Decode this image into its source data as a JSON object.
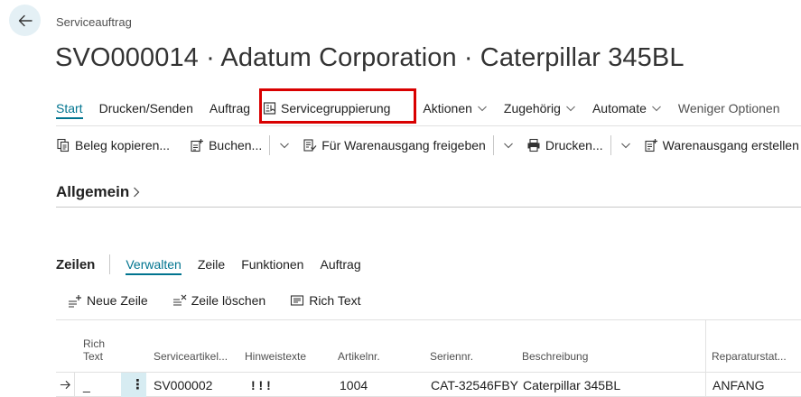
{
  "header": {
    "breadcrumb": "Serviceauftrag",
    "title": "SVO000014 · Adatum Corporation · Caterpillar 345BL"
  },
  "actionbar": {
    "items": [
      {
        "label": "Start"
      },
      {
        "label": "Drucken/Senden"
      },
      {
        "label": "Auftrag"
      },
      {
        "label": "Servicegruppierung"
      },
      {
        "label": "Aktionen"
      },
      {
        "label": "Zugehörig"
      },
      {
        "label": "Automate"
      },
      {
        "label": "Weniger Optionen"
      }
    ]
  },
  "commands": {
    "copy_doc": "Beleg kopieren...",
    "post": "Buchen...",
    "release": "Für Warenausgang freigeben",
    "print": "Drucken...",
    "create_shipment": "Warenausgang erstellen"
  },
  "sections": {
    "general": "Allgemein"
  },
  "lines": {
    "title": "Zeilen",
    "tabs": [
      {
        "label": "Verwalten"
      },
      {
        "label": "Zeile"
      },
      {
        "label": "Funktionen"
      },
      {
        "label": "Auftrag"
      }
    ],
    "commands": {
      "new_line": "Neue Zeile",
      "delete_line": "Zeile löschen",
      "rich_text": "Rich Text"
    },
    "columns": {
      "rich_text_1": "Rich",
      "rich_text_2": "Text",
      "service_item": "Serviceartikel...",
      "notes": "Hinweistexte",
      "item_no": "Artikelnr.",
      "serial_no": "Seriennr.",
      "description": "Beschreibung",
      "repair_status": "Reparaturstat..."
    },
    "rows": [
      {
        "rich_text": "_",
        "service_item": "SV000002",
        "notes": "! ! !",
        "item_no": "1004",
        "serial_no": "CAT-32546FBY",
        "description": "Caterpillar 345BL",
        "repair_status": "ANFANG"
      }
    ]
  }
}
